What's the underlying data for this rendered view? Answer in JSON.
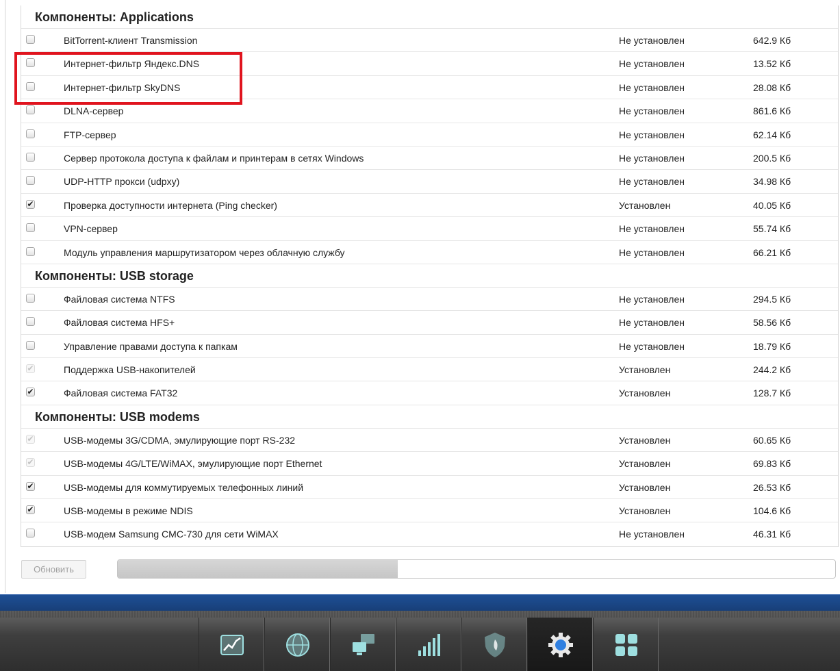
{
  "groups": [
    {
      "title": "Компоненты: Applications",
      "rows": [
        {
          "name": "BitTorrent-клиент Transmission",
          "status": "Не установлен",
          "size": "642.9 Кб",
          "checked": false,
          "disabled": false
        },
        {
          "name": "Интернет-фильтр Яндекс.DNS",
          "status": "Не установлен",
          "size": "13.52 Кб",
          "checked": false,
          "disabled": false
        },
        {
          "name": "Интернет-фильтр SkyDNS",
          "status": "Не установлен",
          "size": "28.08 Кб",
          "checked": false,
          "disabled": false
        },
        {
          "name": "DLNA-сервер",
          "status": "Не установлен",
          "size": "861.6 Кб",
          "checked": false,
          "disabled": false
        },
        {
          "name": "FTP-сервер",
          "status": "Не установлен",
          "size": "62.14 Кб",
          "checked": false,
          "disabled": false
        },
        {
          "name": "Сервер протокола доступа к файлам и принтерам в сетях Windows",
          "status": "Не установлен",
          "size": "200.5 Кб",
          "checked": false,
          "disabled": false
        },
        {
          "name": "UDP-HTTP прокси (udpxy)",
          "status": "Не установлен",
          "size": "34.98 Кб",
          "checked": false,
          "disabled": false
        },
        {
          "name": "Проверка доступности интернета (Ping checker)",
          "status": "Установлен",
          "size": "40.05 Кб",
          "checked": true,
          "disabled": false
        },
        {
          "name": "VPN-сервер",
          "status": "Не установлен",
          "size": "55.74 Кб",
          "checked": false,
          "disabled": false
        },
        {
          "name": "Модуль управления маршрутизатором через облачную службу",
          "status": "Не установлен",
          "size": "66.21 Кб",
          "checked": false,
          "disabled": false
        }
      ]
    },
    {
      "title": "Компоненты: USB storage",
      "rows": [
        {
          "name": "Файловая система NTFS",
          "status": "Не установлен",
          "size": "294.5 Кб",
          "checked": false,
          "disabled": false
        },
        {
          "name": "Файловая система HFS+",
          "status": "Не установлен",
          "size": "58.56 Кб",
          "checked": false,
          "disabled": false
        },
        {
          "name": "Управление правами доступа к папкам",
          "status": "Не установлен",
          "size": "18.79 Кб",
          "checked": false,
          "disabled": false
        },
        {
          "name": "Поддержка USB-накопителей",
          "status": "Установлен",
          "size": "244.2 Кб",
          "checked": true,
          "disabled": true
        },
        {
          "name": "Файловая система FAT32",
          "status": "Установлен",
          "size": "128.7 Кб",
          "checked": true,
          "disabled": false
        }
      ]
    },
    {
      "title": "Компоненты: USB modems",
      "rows": [
        {
          "name": "USB-модемы 3G/CDMA, эмулирующие порт RS-232",
          "status": "Установлен",
          "size": "60.65 Кб",
          "checked": true,
          "disabled": true
        },
        {
          "name": "USB-модемы 4G/LTE/WiMAX, эмулирующие порт Ethernet",
          "status": "Установлен",
          "size": "69.83 Кб",
          "checked": true,
          "disabled": true
        },
        {
          "name": "USB-модемы для коммутируемых телефонных линий",
          "status": "Установлен",
          "size": "26.53 Кб",
          "checked": true,
          "disabled": false
        },
        {
          "name": "USB-модемы в режиме NDIS",
          "status": "Установлен",
          "size": "104.6 Кб",
          "checked": true,
          "disabled": false
        },
        {
          "name": "USB-модем Samsung CMC-730 для сети WiMAX",
          "status": "Не установлен",
          "size": "46.31 Кб",
          "checked": false,
          "disabled": false
        }
      ]
    }
  ],
  "update_button": "Обновить",
  "progress_fraction": 0.39,
  "colors": {
    "highlight": "#e0141e",
    "bluebar": "#1d4f95",
    "dock_icon": "#9edfe0",
    "active_icon": "#2f7fe0"
  },
  "dock": [
    {
      "icon": "chart-icon",
      "active": false
    },
    {
      "icon": "globe-icon",
      "active": false
    },
    {
      "icon": "network-computers-icon",
      "active": false
    },
    {
      "icon": "signal-bars-icon",
      "active": false
    },
    {
      "icon": "shield-icon",
      "active": false
    },
    {
      "icon": "gear-icon",
      "active": true
    },
    {
      "icon": "apps-grid-icon",
      "active": false
    }
  ]
}
